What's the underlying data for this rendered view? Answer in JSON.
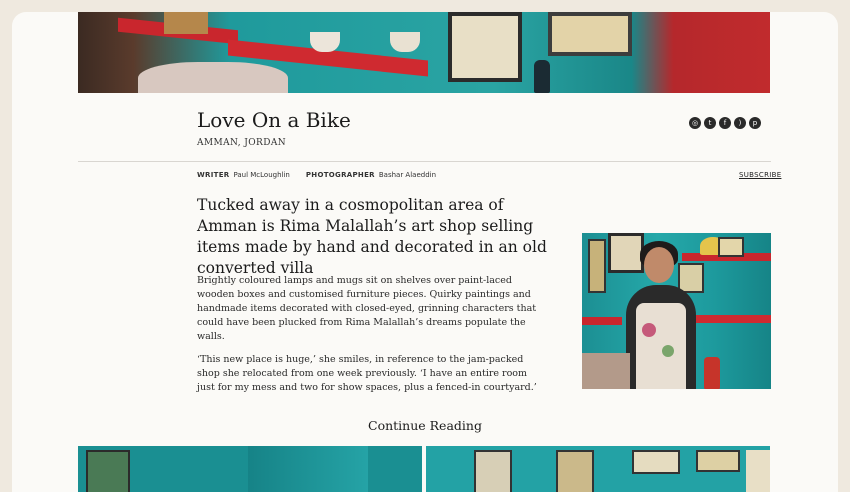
{
  "article": {
    "title": "Love On a Bike",
    "location": "AMMAN, JORDAN",
    "writer_label": "WRITER",
    "writer_name": "Paul McLoughlin",
    "photographer_label": "PHOTOGRAPHER",
    "photographer_name": "Bashar Alaeddin",
    "subscribe": "SUBSCRIBE",
    "lede": "Tucked away in a cosmopolitan area of Amman is Rima Malallah’s art shop selling items made by hand and decorated in an old converted villa",
    "paragraphs": [
      "Brightly coloured lamps and mugs sit on shelves over paint-laced wooden boxes and customised furniture pieces. Quirky paintings and handmade items decorated with closed-eyed, grinning characters that could have been plucked from Rima Malallah’s dreams populate the walls.",
      "‘This new place is huge,’ she smiles, in reference to the jam-packed shop she relocated from one week previously. ‘I have an entire room just for my mess and two for show spaces, plus a fenced-in courtyard.’"
    ],
    "continue_label": "Continue Reading"
  },
  "social": [
    {
      "icon": "instagram-icon"
    },
    {
      "icon": "twitter-icon"
    },
    {
      "icon": "facebook-icon"
    },
    {
      "icon": "rss-icon"
    },
    {
      "icon": "pinterest-icon"
    }
  ],
  "colors": {
    "background": "#efe9df",
    "page": "#fbfaf7",
    "text": "#1b1b1b",
    "teal_wall": "#22a3a6",
    "shelf_red": "#c9262d"
  }
}
